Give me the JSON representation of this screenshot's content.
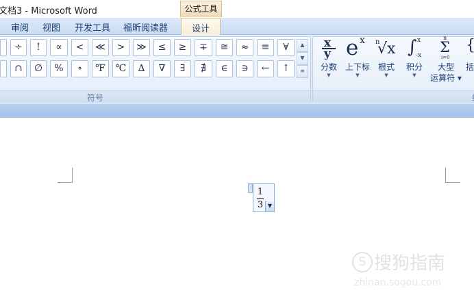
{
  "window": {
    "title": "文档3 - Microsoft Word",
    "context_tab": "公式工具"
  },
  "ribbon_tabs": [
    {
      "label": "审阅",
      "active": false
    },
    {
      "label": "视图",
      "active": false
    },
    {
      "label": "开发工具",
      "active": false
    },
    {
      "label": "福昕阅读器",
      "active": false
    },
    {
      "label": "设计",
      "active": true
    }
  ],
  "symbols": {
    "row1": [
      "÷",
      "!",
      "∝",
      "<",
      "≪",
      ">",
      "≫",
      "≤",
      "≥",
      "∓",
      "≅",
      "≈",
      "≡",
      "∀"
    ],
    "row2": [
      "∩",
      "∅",
      "%",
      "∘",
      "℉",
      "℃",
      "∆",
      "∇",
      "∃",
      "∄",
      "∈",
      "∋",
      "←",
      "↑"
    ],
    "scroll_up": "▲",
    "scroll_down": "▼",
    "group_label": "符号"
  },
  "structures": [
    {
      "label": "分数",
      "icon": "fraction-icon",
      "glyph_top": "x",
      "glyph_bottom": "y"
    },
    {
      "label": "上下标",
      "icon": "superscript-icon",
      "glyph_base": "e",
      "glyph_sup": "x"
    },
    {
      "label": "根式",
      "icon": "radical-icon",
      "glyph_index": "n",
      "glyph_body": "√x"
    },
    {
      "label": "积分",
      "icon": "integral-icon",
      "glyph_body": "∫",
      "glyph_upper": "x",
      "glyph_lower": "-x"
    },
    {
      "label": "大型\n运算符",
      "icon": "large-operator-icon",
      "glyph_upper": "n",
      "glyph_body": "Σ",
      "glyph_lower": "i=0"
    },
    {
      "label": "括",
      "icon": "bracket-icon",
      "glyph_body": "{("
    }
  ],
  "structures_group_label": "结",
  "equation": {
    "numerator": "1",
    "denominator": "3",
    "handle": "⋮",
    "dropdown": "▼"
  },
  "watermark": {
    "text": "搜狗指南",
    "logo": "S",
    "url": "zhinan.sogou.com"
  },
  "colors": {
    "ribbon_bg": "#dce9f8",
    "tab_text": "#1d3f75",
    "context_tab": "#efd9b5"
  }
}
